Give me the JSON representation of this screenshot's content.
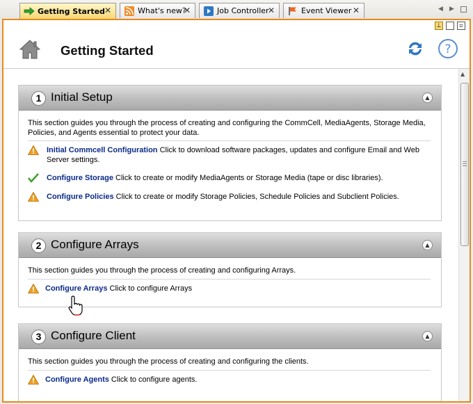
{
  "tabs": [
    {
      "label": "Getting Started",
      "icon": "arrow-right-icon",
      "active": true
    },
    {
      "label": "What's new?",
      "icon": "rss-feed-icon",
      "active": false
    },
    {
      "label": "Job Controller",
      "icon": "play-icon",
      "active": false
    },
    {
      "label": "Event Viewer",
      "icon": "flag-icon",
      "active": false
    }
  ],
  "header": {
    "title": "Getting Started"
  },
  "sections": [
    {
      "number": "1",
      "title": "Initial Setup",
      "description": "This section guides you through the process of creating and configuring the CommCell, MediaAgents, Storage Media, Policies, and Agents essential to protect your data.",
      "items": [
        {
          "status": "warning-icon",
          "link": "Initial Commcell Configuration",
          "text": " Click to download software packages, updates and configure Email and Web Server settings."
        },
        {
          "status": "checkmark-icon",
          "link": "Configure Storage",
          "text": " Click to create or modify MediaAgents or Storage Media (tape or disc libraries)."
        },
        {
          "status": "warning-icon",
          "link": "Configure Policies",
          "text": " Click to create or modify Storage Policies, Schedule Policies and Subclient Policies."
        }
      ]
    },
    {
      "number": "2",
      "title": "Configure Arrays",
      "description": "This section guides you through the process of creating and configuring Arrays.",
      "items": [
        {
          "status": "warning-icon",
          "link": "Configure Arrays",
          "text": " Click to configure Arrays"
        }
      ]
    },
    {
      "number": "3",
      "title": "Configure Client",
      "description": "This section guides you through the process of creating and configuring the clients.",
      "items": [
        {
          "status": "warning-icon",
          "link": "Configure Agents",
          "text": " Click to configure agents."
        }
      ]
    }
  ],
  "colors": {
    "accent_border": "#e48a1d",
    "link": "#0a2a8a",
    "warning": "#f0a020",
    "success": "#3aa02a",
    "icon_blue": "#2f78c4"
  }
}
